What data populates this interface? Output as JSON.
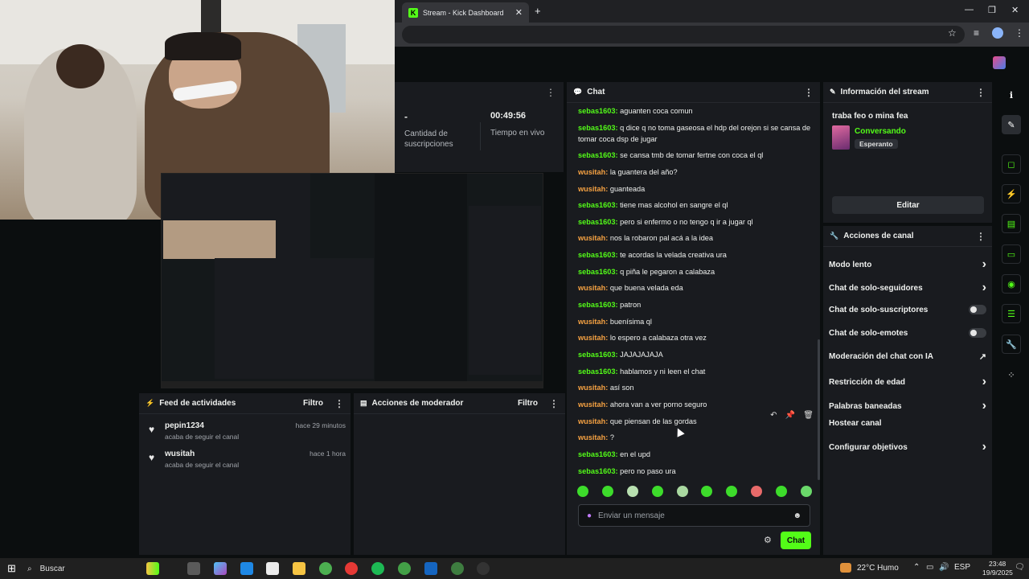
{
  "browser": {
    "tab_title": "Stream - Kick Dashboard",
    "tab_icon": "K",
    "new_tab": "+",
    "close_tab": "✕"
  },
  "stats": {
    "subs_value": "-",
    "subs_label": "Cantidad de suscripciones",
    "live_time": "00:49:56",
    "live_label": "Tiempo en vivo"
  },
  "chat": {
    "title": "Chat",
    "input_placeholder": "Enviar un mensaje",
    "send_label": "Chat",
    "messages": [
      {
        "user": "sebas1603",
        "text": "aguanten coca comun",
        "color": "green"
      },
      {
        "user": "sebas1603",
        "text": "q dice q no toma gaseosa el hdp del orejon si se cansa de tomar coca dsp de jugar",
        "color": "green"
      },
      {
        "user": "sebas1603",
        "text": "se cansa tmb de tomar fertne con coca el ql",
        "color": "green"
      },
      {
        "user": "wusitah",
        "text": "la guantera del año?",
        "color": "orange"
      },
      {
        "user": "wusitah",
        "text": "guanteada",
        "color": "orange"
      },
      {
        "user": "sebas1603",
        "text": "tiene mas alcohol en sangre el ql",
        "color": "green"
      },
      {
        "user": "sebas1603",
        "text": "pero si enfermo o no tengo q ir a jugar ql",
        "color": "green"
      },
      {
        "user": "wusitah",
        "text": "nos la robaron pal acá a la idea",
        "color": "orange"
      },
      {
        "user": "sebas1603",
        "text": "te acordas la velada creativa ura",
        "color": "green"
      },
      {
        "user": "sebas1603",
        "text": "q piña le pegaron a calabaza",
        "color": "green"
      },
      {
        "user": "wusitah",
        "text": "que buena velada eda",
        "color": "orange"
      },
      {
        "user": "sebas1603",
        "text": "patron",
        "color": "green"
      },
      {
        "user": "wusitah",
        "text": "buenísima ql",
        "color": "orange"
      },
      {
        "user": "wusitah",
        "text": "lo espero a calabaza otra vez",
        "color": "orange"
      },
      {
        "user": "sebas1603",
        "text": "JAJAJAJAJA",
        "color": "green"
      },
      {
        "user": "sebas1603",
        "text": "hablamos y ni leen el chat",
        "color": "green"
      },
      {
        "user": "wusitah",
        "text": "así son",
        "color": "orange"
      },
      {
        "user": "wusitah",
        "text": "ahora van a ver porno seguro",
        "color": "orange"
      },
      {
        "user": "wusitah",
        "text": "que piensan de las gordas",
        "color": "orange"
      },
      {
        "user": "wusitah",
        "text": "?",
        "color": "orange"
      },
      {
        "user": "sebas1603",
        "text": "en el upd",
        "color": "green"
      },
      {
        "user": "sebas1603",
        "text": "pero no paso ura",
        "color": "green"
      }
    ]
  },
  "stream_info": {
    "title": "Información del stream",
    "stream_title": "traba feo o mina fea",
    "category": "Conversando",
    "badge": "Esperanto",
    "edit_label": "Editar"
  },
  "channel_actions": {
    "title": "Acciones de canal",
    "items": [
      {
        "label": "Modo lento",
        "type": "arrow"
      },
      {
        "label": "Chat de solo-seguidores",
        "type": "arrow"
      },
      {
        "label": "Chat de solo-suscriptores",
        "type": "toggle"
      },
      {
        "label": "Chat de solo-emotes",
        "type": "toggle"
      },
      {
        "label": "Moderación del chat con IA",
        "type": "external"
      },
      {
        "label": "Restricción de edad",
        "type": "arrow"
      },
      {
        "label": "Palabras baneadas",
        "type": "arrow"
      },
      {
        "label": "Hostear canal",
        "type": "none"
      },
      {
        "label": "Configurar objetivos",
        "type": "arrow"
      }
    ]
  },
  "feed": {
    "title": "Feed de actividades",
    "filter": "Filtro",
    "items": [
      {
        "name": "pepin1234",
        "time": "hace 29 minutos",
        "desc": "acaba de seguir el canal"
      },
      {
        "name": "wusitah",
        "time": "hace 1 hora",
        "desc": "acaba de seguir el canal"
      }
    ]
  },
  "moderator": {
    "title": "Acciones de moderador",
    "filter": "Filtro"
  },
  "taskbar": {
    "search": "Buscar",
    "weather": "22°C  Humo",
    "lang": "ESP",
    "time": "23:48",
    "date": "19/9/2025"
  },
  "colors": {
    "accent": "#53fc18",
    "user_orange": "#f5a142",
    "panel": "#191b1f",
    "background": "#0b0e0f"
  }
}
